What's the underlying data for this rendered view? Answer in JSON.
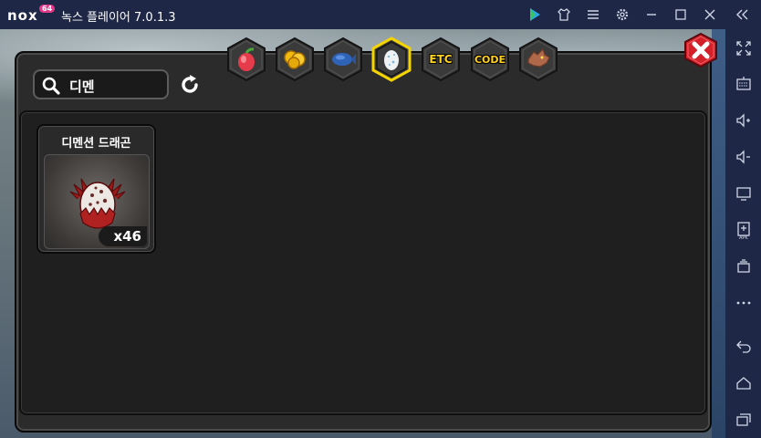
{
  "window": {
    "brand": "nox",
    "brand_badge": "64",
    "title": "녹스 플레이어 7.0.1.3"
  },
  "search": {
    "value": "디멘"
  },
  "tabs": [
    {
      "name": "fruit",
      "label": ""
    },
    {
      "name": "gold",
      "label": ""
    },
    {
      "name": "fish",
      "label": ""
    },
    {
      "name": "egg",
      "label": "",
      "active": true
    },
    {
      "name": "etc",
      "label": "ETC"
    },
    {
      "name": "code",
      "label": "CODE"
    },
    {
      "name": "dragon",
      "label": ""
    }
  ],
  "items": [
    {
      "name": "디멘션 드래곤",
      "count": "x46"
    }
  ],
  "colors": {
    "active_tab_border": "#f5d400",
    "close_button": "#d42028",
    "accent_tab_text": "#ffd21f"
  }
}
